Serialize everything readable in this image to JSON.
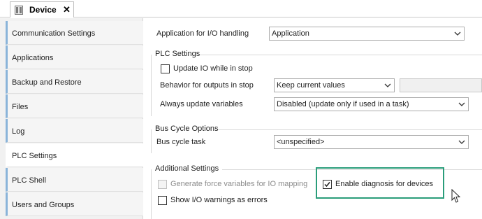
{
  "tab": {
    "title": "Device",
    "close_glyph": "✕",
    "icon": "device-icon"
  },
  "nav": {
    "items": [
      {
        "label": "Communication Settings",
        "active": false
      },
      {
        "label": "Applications",
        "active": false
      },
      {
        "label": "Backup and Restore",
        "active": false
      },
      {
        "label": "Files",
        "active": false
      },
      {
        "label": "Log",
        "active": false
      },
      {
        "label": "PLC Settings",
        "active": true
      },
      {
        "label": "PLC Shell",
        "active": false
      },
      {
        "label": "Users and Groups",
        "active": false
      }
    ]
  },
  "settings": {
    "app_io_label": "Application for I/O handling",
    "app_io_value": "Application",
    "plc_group_title": "PLC Settings",
    "update_io_label": "Update IO while in stop",
    "update_io_checked": false,
    "behavior_label": "Behavior for outputs in stop",
    "behavior_value": "Keep current values",
    "always_update_label": "Always update variables",
    "always_update_value": "Disabled (update only if used in a task)",
    "bus_group_title": "Bus Cycle Options",
    "bus_task_label": "Bus cycle task",
    "bus_task_value": "<unspecified>",
    "additional_group_title": "Additional Settings",
    "force_vars_label": "Generate force variables for IO mapping",
    "force_vars_checked": false,
    "force_vars_enabled": false,
    "enable_diag_label": "Enable diagnosis for devices",
    "enable_diag_checked": true,
    "show_warnings_label": "Show I/O warnings as errors",
    "show_warnings_checked": false
  },
  "colors": {
    "highlight": "#2a9d7a",
    "nav_accent": "#8ab4d9"
  }
}
